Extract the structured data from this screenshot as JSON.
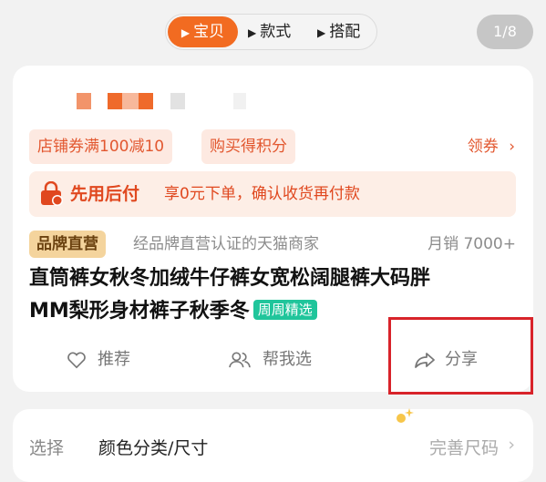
{
  "tabs": [
    {
      "label": "宝贝",
      "active": true
    },
    {
      "label": "款式",
      "active": false
    },
    {
      "label": "搭配",
      "active": false
    }
  ],
  "page_indicator": "1/8",
  "coupons": [
    "店铺券满100减10",
    "购买得积分"
  ],
  "claim_label": "领券",
  "pay_later": {
    "title": "先用后付",
    "desc": "享0元下单，确认收货再付款"
  },
  "brand": {
    "badge": "品牌直营",
    "text": "经品牌直营认证的天猫商家",
    "sales": "月销 7000+"
  },
  "product": {
    "title_line1": "直筒裤女秋冬加绒牛仔裤女宽松阔腿裤大码胖",
    "title_line2": "MM梨形身材裤子秋季冬",
    "tag": "周周精选"
  },
  "actions": {
    "recommend": "推荐",
    "help_choose": "帮我选",
    "share": "分享"
  },
  "selection": {
    "label": "选择",
    "value": "颜色分类/尺寸",
    "link": "完善尺码",
    "chevron": "›"
  },
  "colors": {
    "accent": "#f26b21",
    "coupon_text": "#e2572f",
    "highlight_box": "#d8232a",
    "tag_green": "#20c59b"
  }
}
